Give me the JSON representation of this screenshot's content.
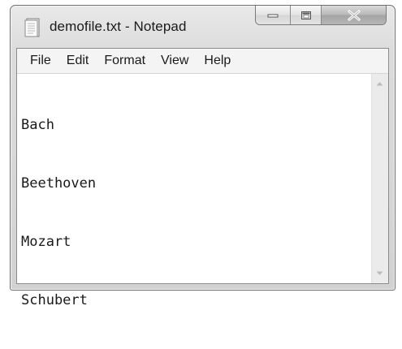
{
  "window": {
    "title": "demofile.txt - Notepad",
    "icon": "notepad-document-icon",
    "caption_buttons": [
      "minimize-icon",
      "maximize-icon",
      "close-icon"
    ]
  },
  "menubar": {
    "items": [
      {
        "label": "File"
      },
      {
        "label": "Edit"
      },
      {
        "label": "Format"
      },
      {
        "label": "View"
      },
      {
        "label": "Help"
      }
    ]
  },
  "editor": {
    "lines": [
      "Bach",
      "Beethoven",
      "Mozart",
      "Schubert"
    ]
  },
  "colors": {
    "window_frame": "#d2d2d2",
    "editor_background": "#ffffff",
    "text": "#1a1a1a"
  }
}
